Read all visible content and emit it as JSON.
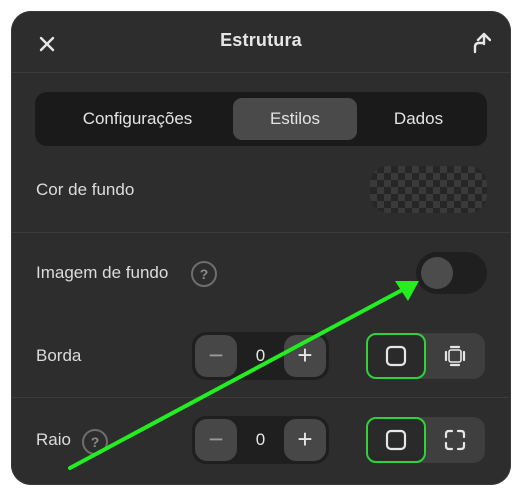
{
  "header": {
    "title": "Estrutura",
    "close_icon": "close-icon",
    "share_icon": "share-arrow-icon"
  },
  "tabs": [
    {
      "label": "Configurações",
      "active": false
    },
    {
      "label": "Estilos",
      "active": true
    },
    {
      "label": "Dados",
      "active": false
    }
  ],
  "rows": {
    "background_color": {
      "label": "Cor de fundo",
      "value": "transparent"
    },
    "background_image": {
      "label": "Imagem de fundo",
      "help_icon": "help-icon",
      "toggle_on": false
    },
    "border": {
      "label": "Borda",
      "value": "0",
      "minus": "−",
      "plus": "+"
    },
    "radius": {
      "label": "Raio",
      "help_icon": "help-icon",
      "value": "0",
      "minus": "−",
      "plus": "+"
    }
  },
  "help_glyph": "?",
  "colors": {
    "panel": "#2d2d2d",
    "accent_green": "#2ed33a",
    "annotation_arrow": "#22ee22"
  }
}
